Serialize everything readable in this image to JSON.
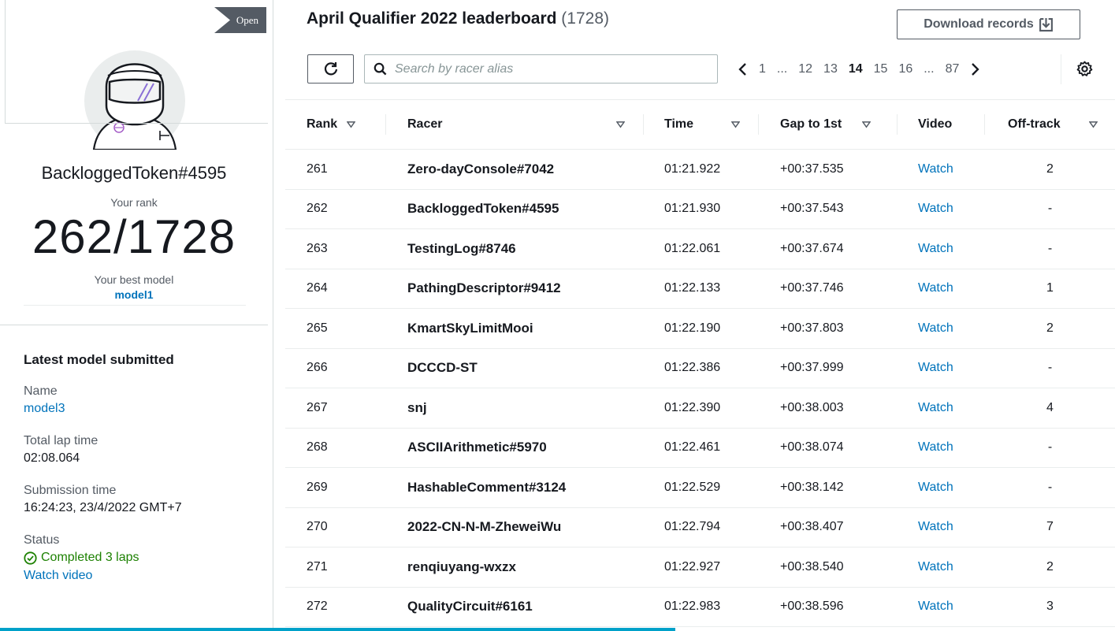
{
  "profile": {
    "open_tag": "Open",
    "racer_name": "BackloggedToken#4595",
    "rank_label": "Your rank",
    "rank_value": "262/1728",
    "best_model_label": "Your best model",
    "best_model_value": "model1"
  },
  "latest_model": {
    "heading": "Latest model submitted",
    "name_label": "Name",
    "name_value": "model3",
    "lap_time_label": "Total lap time",
    "lap_time_value": "02:08.064",
    "submission_label": "Submission time",
    "submission_value": "16:24:23, 23/4/2022 GMT+7",
    "status_label": "Status",
    "status_value": "Completed 3 laps",
    "watch_video": "Watch video"
  },
  "leaderboard": {
    "title": "April Qualifier 2022 leaderboard",
    "count": "(1728)",
    "download_label": "Download records",
    "search_placeholder": "Search by racer alias",
    "pagination": [
      "1",
      "...",
      "12",
      "13",
      "14",
      "15",
      "16",
      "...",
      "87"
    ],
    "current_page": "14",
    "columns": {
      "rank": "Rank",
      "racer": "Racer",
      "time": "Time",
      "gap": "Gap to 1st",
      "video": "Video",
      "offtrack": "Off-track"
    },
    "rows": [
      {
        "rank": "261",
        "racer": "Zero-dayConsole#7042",
        "time": "01:21.922",
        "gap": "+00:37.535",
        "video": "Watch",
        "offtrack": "2"
      },
      {
        "rank": "262",
        "racer": "BackloggedToken#4595",
        "time": "01:21.930",
        "gap": "+00:37.543",
        "video": "Watch",
        "offtrack": "-"
      },
      {
        "rank": "263",
        "racer": "TestingLog#8746",
        "time": "01:22.061",
        "gap": "+00:37.674",
        "video": "Watch",
        "offtrack": "-"
      },
      {
        "rank": "264",
        "racer": "PathingDescriptor#9412",
        "time": "01:22.133",
        "gap": "+00:37.746",
        "video": "Watch",
        "offtrack": "1"
      },
      {
        "rank": "265",
        "racer": "KmartSkyLimitMooi",
        "time": "01:22.190",
        "gap": "+00:37.803",
        "video": "Watch",
        "offtrack": "2"
      },
      {
        "rank": "266",
        "racer": "DCCCD-ST",
        "time": "01:22.386",
        "gap": "+00:37.999",
        "video": "Watch",
        "offtrack": "-"
      },
      {
        "rank": "267",
        "racer": "snj",
        "time": "01:22.390",
        "gap": "+00:38.003",
        "video": "Watch",
        "offtrack": "4"
      },
      {
        "rank": "268",
        "racer": "ASCIIArithmetic#5970",
        "time": "01:22.461",
        "gap": "+00:38.074",
        "video": "Watch",
        "offtrack": "-"
      },
      {
        "rank": "269",
        "racer": "HashableComment#3124",
        "time": "01:22.529",
        "gap": "+00:38.142",
        "video": "Watch",
        "offtrack": "-"
      },
      {
        "rank": "270",
        "racer": "2022-CN-N-M-ZheweiWu",
        "time": "01:22.794",
        "gap": "+00:38.407",
        "video": "Watch",
        "offtrack": "7"
      },
      {
        "rank": "271",
        "racer": "renqiuyang-wxzx",
        "time": "01:22.927",
        "gap": "+00:38.540",
        "video": "Watch",
        "offtrack": "2"
      },
      {
        "rank": "272",
        "racer": "QualityCircuit#6161",
        "time": "01:22.983",
        "gap": "+00:38.596",
        "video": "Watch",
        "offtrack": "3"
      }
    ]
  },
  "icons": {
    "refresh": "refresh-icon",
    "search": "search-icon",
    "download": "download-icon",
    "settings": "gear-icon",
    "sort": "sort-down-icon",
    "prev": "chevron-left-icon",
    "next": "chevron-right-icon",
    "status": "check-circle-icon"
  },
  "colors": {
    "link": "#0073bb",
    "success": "#1d8102",
    "accent_bar": "#00a1c9",
    "tag_bg": "#545b64"
  }
}
